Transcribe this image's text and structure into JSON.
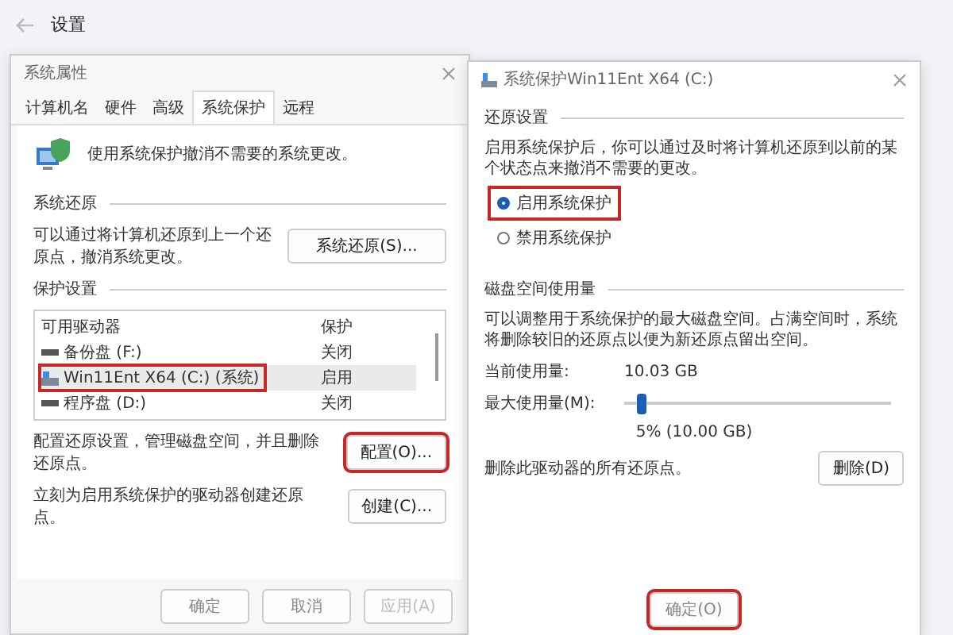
{
  "settings_window": {
    "title": "设置"
  },
  "system_properties": {
    "title": "系统属性",
    "tabs": [
      {
        "label": "计算机名",
        "selected": false
      },
      {
        "label": "硬件",
        "selected": false
      },
      {
        "label": "高级",
        "selected": false
      },
      {
        "label": "系统保护",
        "selected": true
      },
      {
        "label": "远程",
        "selected": false
      }
    ],
    "intro": "使用系统保护撤消不需要的系统更改。",
    "restore_section": {
      "heading": "系统还原",
      "text": "可以通过将计算机还原到上一个还原点，撤消系统更改。",
      "button": "系统还原(S)..."
    },
    "protection_section": {
      "heading": "保护设置",
      "columns": [
        "可用驱动器",
        "保护"
      ],
      "drives": [
        {
          "name": "备份盘 (F:)",
          "protection": "关闭",
          "kind": "data",
          "selected": false,
          "highlighted": false
        },
        {
          "name": "Win11Ent X64 (C:) (系统)",
          "protection": "启用",
          "kind": "system",
          "selected": true,
          "highlighted": true
        },
        {
          "name": "程序盘 (D:)",
          "protection": "关闭",
          "kind": "data",
          "selected": false,
          "highlighted": false
        }
      ],
      "configure_text": "配置还原设置，管理磁盘空间，并且删除还原点。",
      "configure_button": {
        "label": "配置(O)...",
        "highlighted": true
      },
      "create_text": "立刻为启用系统保护的驱动器创建还原点。",
      "create_button": "创建(C)..."
    },
    "buttons": [
      {
        "label": "确定",
        "disabled": false
      },
      {
        "label": "取消",
        "disabled": false
      },
      {
        "label": "应用(A)",
        "disabled": true
      }
    ]
  },
  "protection_dialog": {
    "title": "系统保护Win11Ent X64 (C:)",
    "restore_heading": "还原设置",
    "restore_text": "启用系统保护后，你可以通过及时将计算机还原到以前的某个状态点来撤消不需要的更改。",
    "options": [
      {
        "label": "启用系统保护",
        "selected": true,
        "highlighted": true
      },
      {
        "label": "禁用系统保护",
        "selected": false,
        "highlighted": false
      }
    ],
    "disk_heading": "磁盘空间使用量",
    "disk_text": "可以调整用于系统保护的最大磁盘空间。占满空间时，系统将删除较旧的还原点以便为新还原点留出空间。",
    "current_label": "当前使用量:",
    "current_value": "10.03 GB",
    "max_label": "最大使用量(M):",
    "max_usage": {
      "level": 0.05
    },
    "max_reading": "5% (10.00 GB)",
    "delete_text": "删除此驱动器的所有还原点。",
    "delete_button": "删除(D)",
    "buttons": [
      {
        "label": "确定(O)",
        "highlighted": true
      }
    ]
  }
}
